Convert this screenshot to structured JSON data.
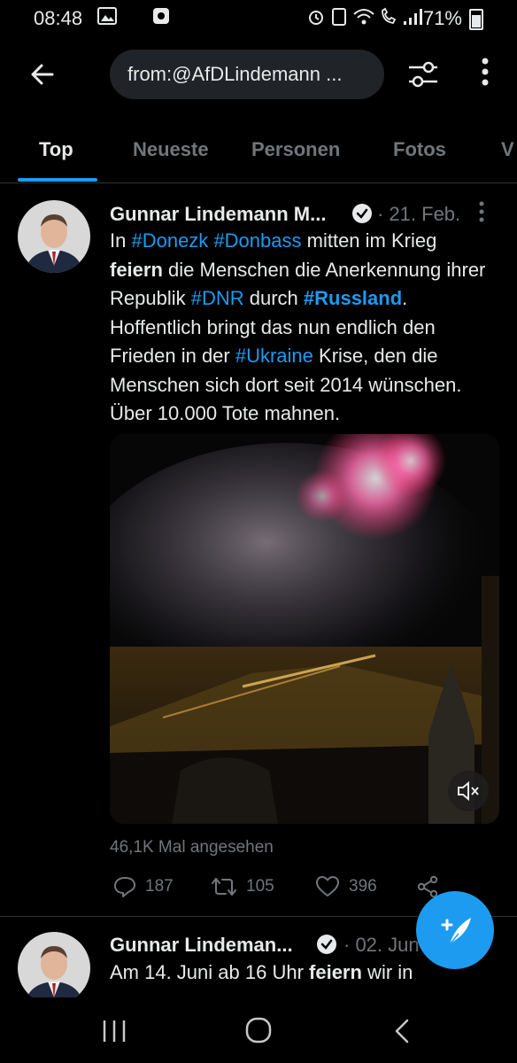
{
  "status_bar": {
    "time": "08:48",
    "battery": "71%"
  },
  "top_bar": {
    "search_query": "from:@AfDLindemann ..."
  },
  "tabs": [
    {
      "label": "Top",
      "active": true
    },
    {
      "label": "Neueste"
    },
    {
      "label": "Personen"
    },
    {
      "label": "Fotos"
    },
    {
      "label": "V"
    }
  ],
  "tweets": [
    {
      "author": "Gunnar Lindemann M...",
      "date": "· 21. Feb.",
      "text_parts": [
        "In ",
        "#Donezk",
        " ",
        "#Donbass",
        " mitten im Krieg ",
        "feiern",
        " die Menschen die Anerkennung ihrer Republik ",
        "#DNR",
        " durch ",
        "#Russland",
        ". Hoffentlich bringt das nun endlich den Frieden in der ",
        "#Ukraine",
        " Krise, den die Menschen sich dort seit 2014 wünschen. Über 10.000 Tote mahnen."
      ],
      "views": "46,1K Mal angesehen",
      "replies": "187",
      "retweets": "105",
      "likes": "396"
    },
    {
      "author": "Gunnar Lindeman...",
      "date": "· 02. Jun",
      "text_parts": [
        "Am 14. Juni ab 16 Uhr ",
        "feiern",
        " wir in"
      ]
    }
  ],
  "colors": {
    "accent": "#1d9bf0",
    "muted": "#71767b",
    "background": "#000000",
    "text": "#e7e9ea"
  }
}
